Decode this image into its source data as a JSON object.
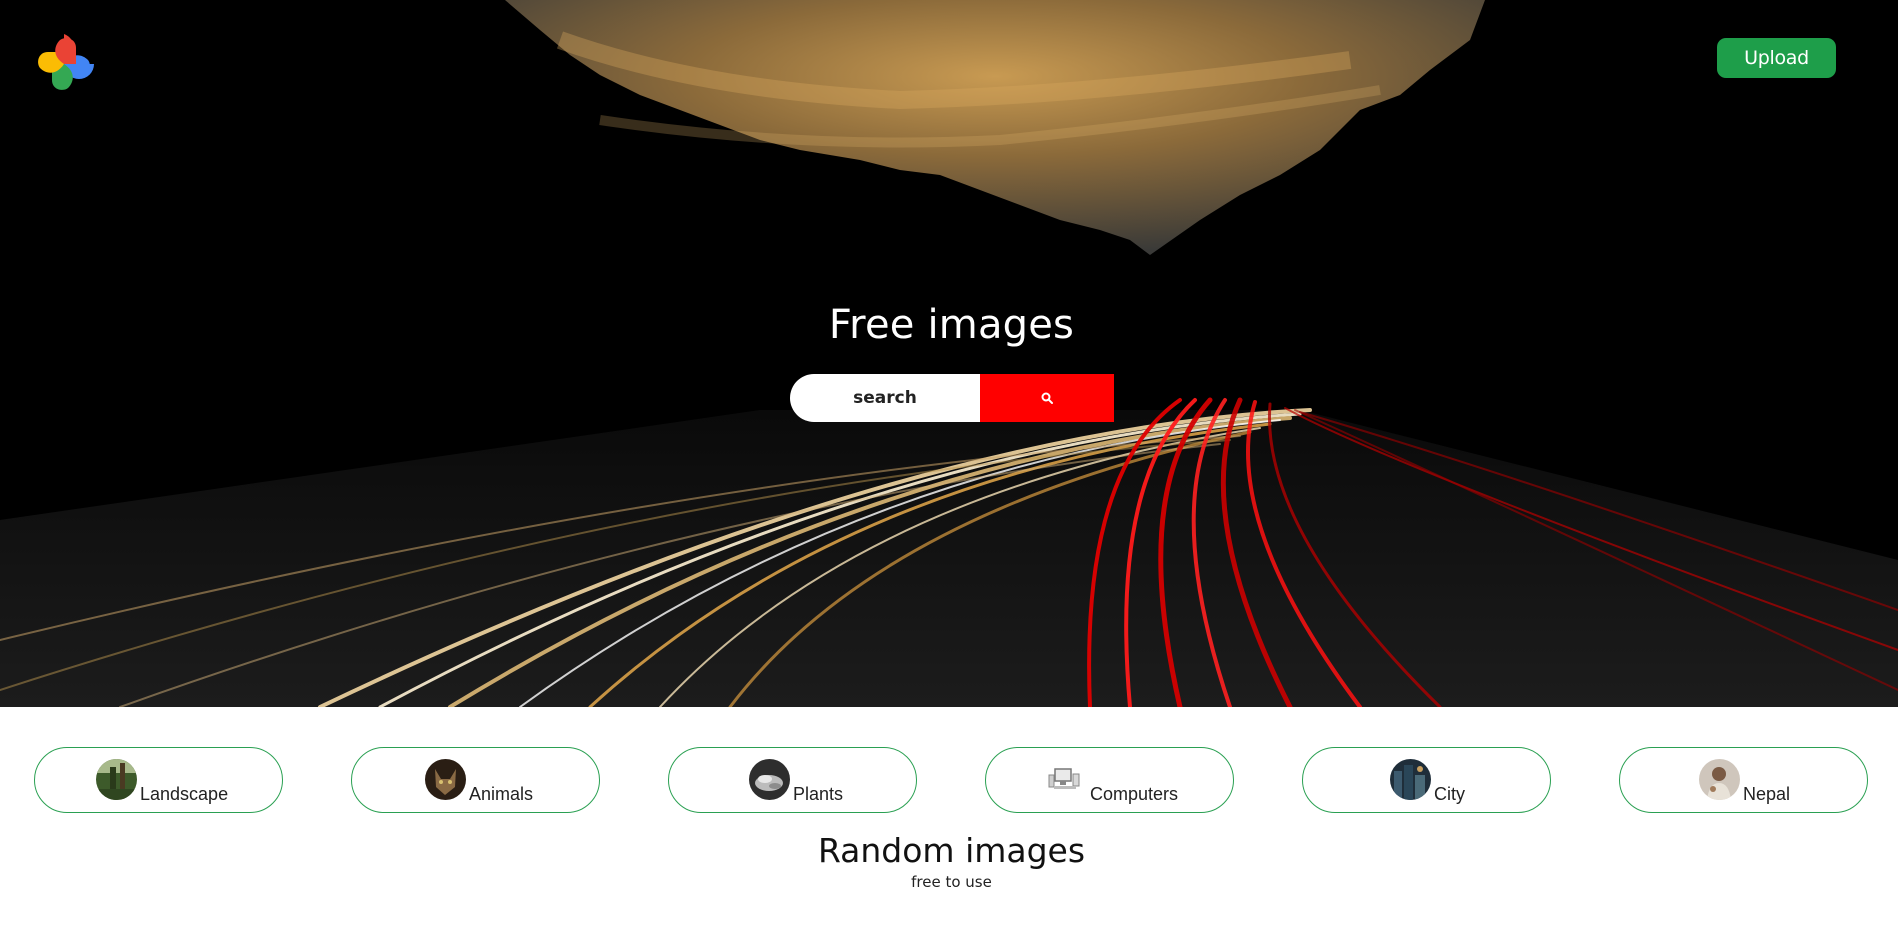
{
  "header": {
    "logo_icon": "pinwheel-logo-icon",
    "upload_label": "Upload",
    "upload_color": "#1e9e4a"
  },
  "hero": {
    "title": "Free images",
    "search": {
      "placeholder": "search",
      "value": ""
    },
    "search_button_icon": "search-icon",
    "search_button_color": "#ff0000"
  },
  "categories": [
    {
      "label": "Landscape",
      "thumb": "landscape-thumbnail"
    },
    {
      "label": "Animals",
      "thumb": "animals-thumbnail"
    },
    {
      "label": "Plants",
      "thumb": "plants-thumbnail"
    },
    {
      "label": "Computers",
      "thumb": "computers-thumbnail"
    },
    {
      "label": "City",
      "thumb": "city-thumbnail"
    },
    {
      "label": "Nepal",
      "thumb": "nepal-thumbnail"
    }
  ],
  "section": {
    "title": "Random images",
    "subtitle": "free to use"
  },
  "colors": {
    "accent_green": "#2aa052",
    "search_red": "#ff0000"
  }
}
